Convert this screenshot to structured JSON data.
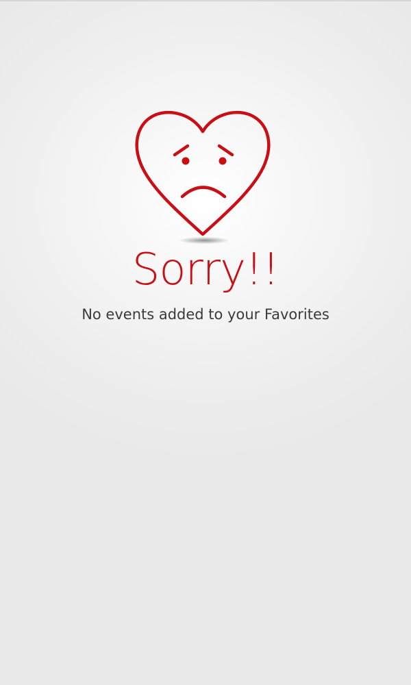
{
  "empty_state": {
    "icon": "sad-heart-icon",
    "title": "Sorry!!",
    "message": "No events added to your Favorites"
  },
  "colors": {
    "accent": "#c80f15",
    "text": "#3a3a3a",
    "background": "#e9e9e9"
  }
}
